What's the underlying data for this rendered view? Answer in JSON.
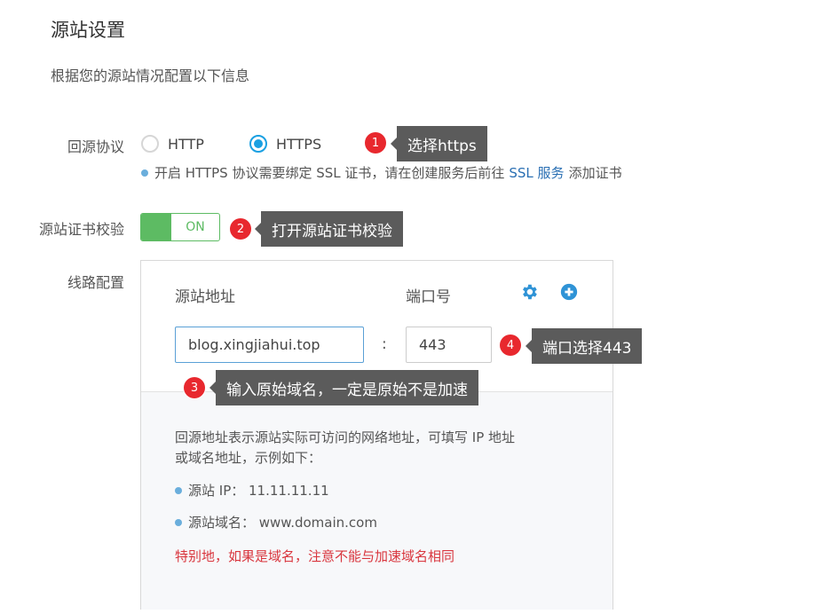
{
  "page": {
    "title": "源站设置",
    "description": "根据您的源站情况配置以下信息"
  },
  "protocol": {
    "label": "回源协议",
    "options": [
      {
        "label": "HTTP",
        "selected": false
      },
      {
        "label": "HTTPS",
        "selected": true
      }
    ],
    "hint_before": "开启 HTTPS 协议需要绑定 SSL 证书，请在创建服务后前往",
    "hint_link": "SSL 服务",
    "hint_after": "添加证书"
  },
  "cert_check": {
    "label": "源站证书校验",
    "toggle_text": "ON",
    "enabled": true
  },
  "route": {
    "label": "线路配置",
    "address_header": "源站地址",
    "port_header": "端口号",
    "address_value": "blog.xingjiahui.top",
    "separator": ":",
    "port_value": "443",
    "icons": {
      "settings": "gear-icon",
      "add": "plus-circle-icon"
    },
    "info_line1": "回源地址表示源站实际可访问的网络地址，可填写 IP 地址",
    "info_line2": "或域名地址，示例如下：",
    "example_ip": "源站 IP： 11.11.11.11",
    "example_domain": "源站域名： www.domain.com",
    "warning": "特别地，如果是域名，注意不能与加速域名相同"
  },
  "annotations": [
    {
      "number": "1",
      "text": "选择https"
    },
    {
      "number": "2",
      "text": "打开源站证书校验"
    },
    {
      "number": "3",
      "text": "输入原始域名，一定是原始不是加速"
    },
    {
      "number": "4",
      "text": "端口选择443"
    }
  ],
  "colors": {
    "accent": "#1aa0e2",
    "toggle": "#5dbb63",
    "link": "#2a6fb3",
    "badge": "#e8282e",
    "tooltip": "#5b5b5b",
    "warning": "#d9363e"
  }
}
